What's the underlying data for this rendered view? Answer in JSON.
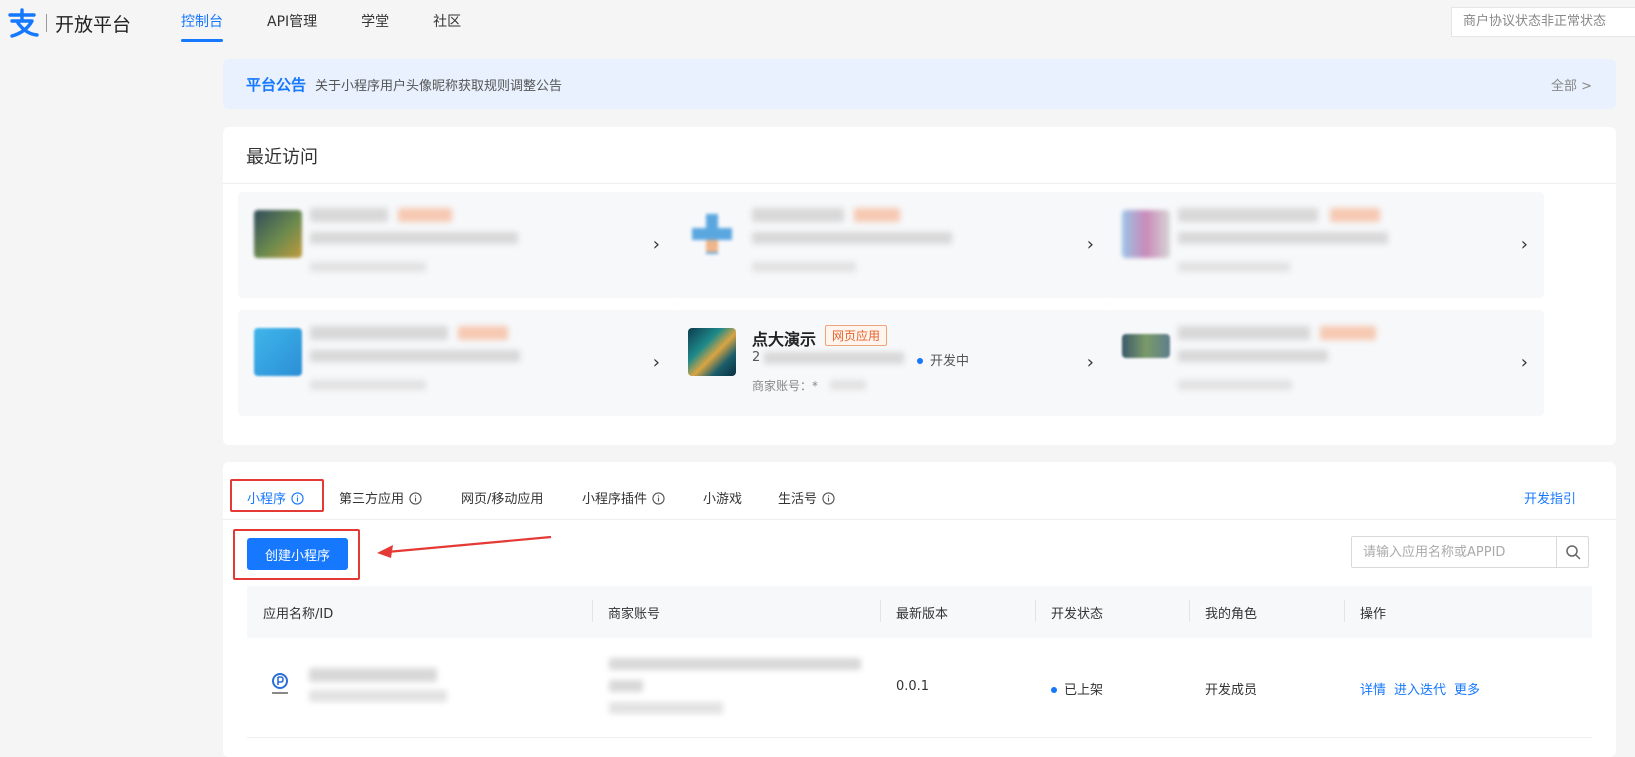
{
  "header": {
    "brand": "开放平台",
    "nav": [
      {
        "label": "控制台",
        "active": true
      },
      {
        "label": "API管理",
        "active": false
      },
      {
        "label": "学堂",
        "active": false
      },
      {
        "label": "社区",
        "active": false
      }
    ],
    "notice": "商户协议状态非正常状态"
  },
  "announcement": {
    "title": "平台公告",
    "text": "关于小程序用户头像昵称获取规则调整公告",
    "all_link": "全部 >"
  },
  "recent": {
    "title": "最近访问",
    "featured_tile": {
      "name": "点大演示",
      "tag": "网页应用",
      "id_prefix": "2",
      "status": "开发中",
      "merchant_label": "商家账号：*"
    }
  },
  "apps": {
    "tabs": [
      {
        "label": "小程序",
        "info": true,
        "active": true
      },
      {
        "label": "第三方应用",
        "info": true,
        "active": false
      },
      {
        "label": "网页/移动应用",
        "info": false,
        "active": false
      },
      {
        "label": "小程序插件",
        "info": true,
        "active": false
      },
      {
        "label": "小游戏",
        "info": false,
        "active": false
      },
      {
        "label": "生活号",
        "info": true,
        "active": false
      }
    ],
    "dev_guide": "开发指引",
    "create_button": "创建小程序",
    "search_placeholder": "请输入应用名称或APPID",
    "table": {
      "columns": [
        "应用名称/ID",
        "商家账号",
        "最新版本",
        "开发状态",
        "我的角色",
        "操作"
      ],
      "rows": [
        {
          "version": "0.0.1",
          "status": "已上架",
          "role": "开发成员",
          "actions": [
            "详情",
            "进入迭代",
            "更多"
          ]
        }
      ]
    }
  },
  "colors": {
    "primary": "#1677ff",
    "highlight": "#e53935",
    "tag_orange": "#e5622a"
  }
}
